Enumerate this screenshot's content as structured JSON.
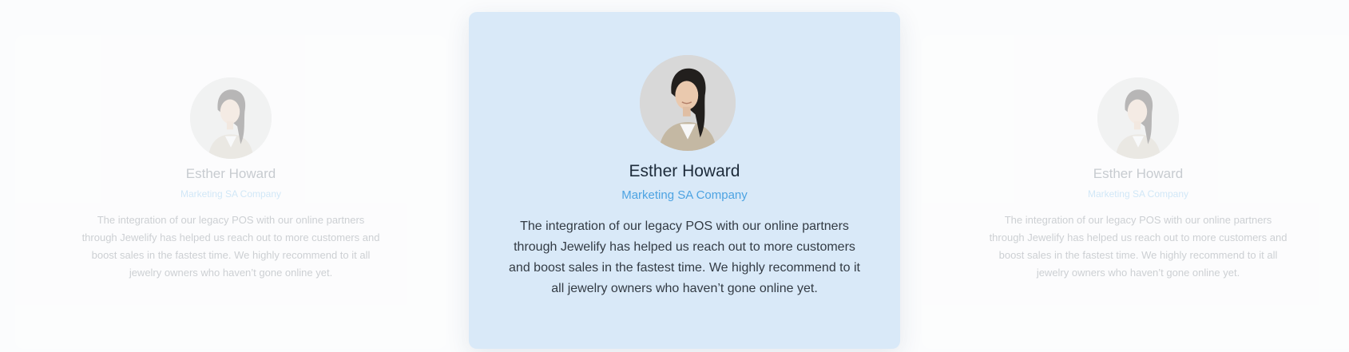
{
  "carousel": {
    "cards": [
      {
        "name": "Esther Howard",
        "company": "Marketing SA Company",
        "quote": "The integration of our legacy POS with our online partners through Jewelify has helped us reach out to more customers and boost sales in the fastest time. We highly recommend to it all jewelry owners who haven’t gone online yet.",
        "avatar_icon": "person-portrait-icon",
        "state": "inactive"
      },
      {
        "name": "Esther Howard",
        "company": "Marketing SA Company",
        "quote": "The integration of our legacy POS with our online partners through Jewelify has helped us reach out to more customers and boost sales in the fastest time. We highly recommend to it all jewelry owners who haven’t gone online yet.",
        "avatar_icon": "person-portrait-icon",
        "state": "active"
      },
      {
        "name": "Esther Howard",
        "company": "Marketing SA Company",
        "quote": "The integration of our legacy POS with our online partners through Jewelify has helped us reach out to more customers and boost sales in the fastest time. We highly recommend to it all jewelry owners who haven’t gone online yet.",
        "avatar_icon": "person-portrait-icon",
        "state": "inactive"
      }
    ]
  },
  "colors": {
    "active_card_bg": "#d9e9f8",
    "name": "#1d2b3a",
    "company_accent": "#4da3e2",
    "quote_text": "#333b44"
  }
}
